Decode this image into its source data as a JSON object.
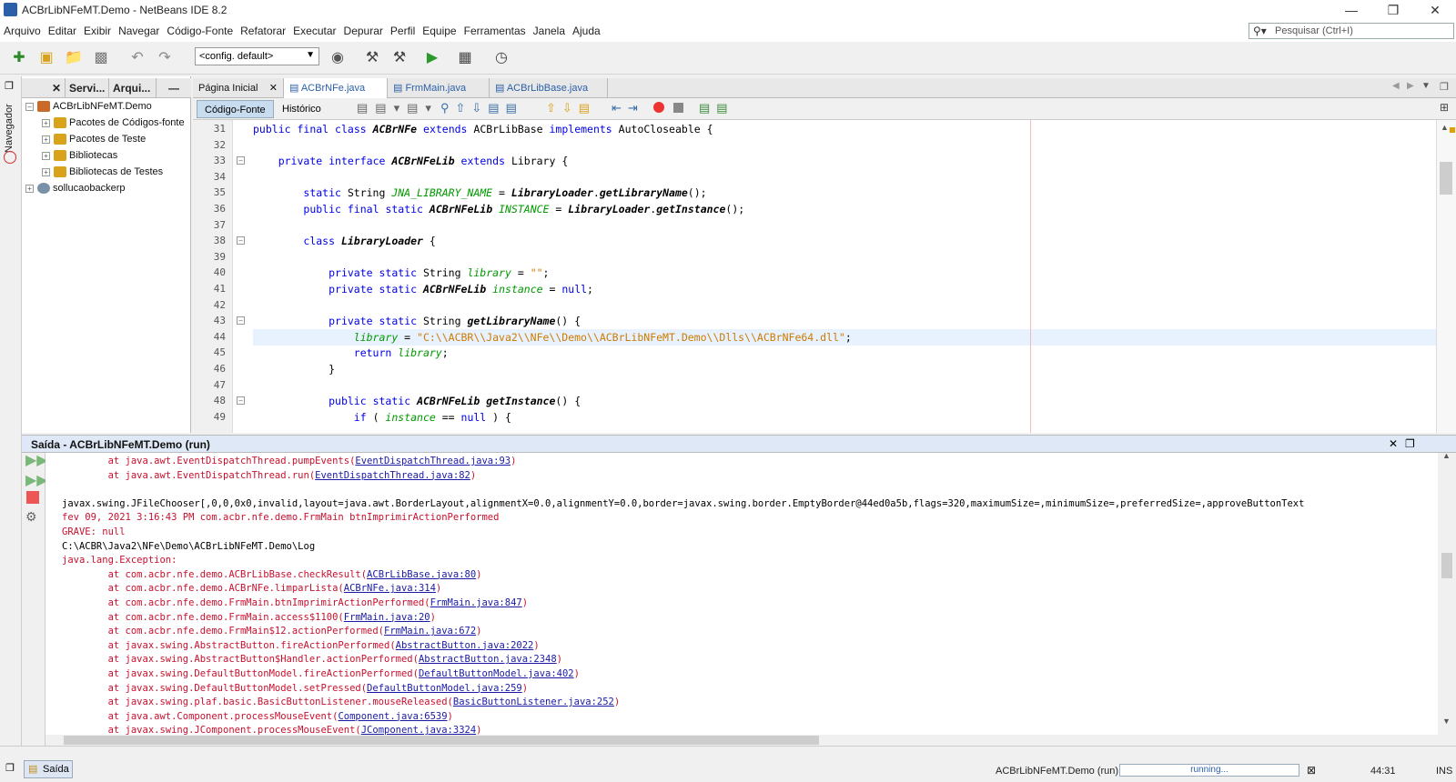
{
  "window": {
    "title": "ACBrLibNFeMT.Demo - NetBeans IDE 8.2"
  },
  "menu": [
    "Arquivo",
    "Editar",
    "Exibir",
    "Navegar",
    "Código-Fonte",
    "Refatorar",
    "Executar",
    "Depurar",
    "Perfil",
    "Equipe",
    "Ferramentas",
    "Janela",
    "Ajuda"
  ],
  "search": {
    "placeholder": "Pesquisar (Ctrl+I)"
  },
  "toolbar": {
    "config": "<config. default>"
  },
  "navigator_label": "Navegador",
  "project_tabs": [
    "Servi...",
    "Arqui..."
  ],
  "tree": [
    {
      "label": "ACBrLibNFeMT.Demo",
      "depth": 0
    },
    {
      "label": "Pacotes de Códigos-fonte",
      "depth": 1
    },
    {
      "label": "Pacotes de Teste",
      "depth": 1
    },
    {
      "label": "Bibliotecas",
      "depth": 1
    },
    {
      "label": "Bibliotecas de Testes",
      "depth": 1
    },
    {
      "label": "sollucaobackerp",
      "depth": 0
    }
  ],
  "editor_tabs": [
    {
      "label": "Página Inicial",
      "active": false
    },
    {
      "label": "ACBrNFe.java",
      "active": true
    },
    {
      "label": "FrmMain.java",
      "active": false
    },
    {
      "label": "ACBrLibBase.java",
      "active": false
    }
  ],
  "editor_views": {
    "source": "Código-Fonte",
    "history": "Histórico"
  },
  "code": [
    {
      "n": "31",
      "t": "public final class ACBrNFe extends ACBrLibBase implements AutoCloseable {"
    },
    {
      "n": "32",
      "t": ""
    },
    {
      "n": "33",
      "t": "    private interface ACBrNFeLib extends Library {"
    },
    {
      "n": "34",
      "t": ""
    },
    {
      "n": "35",
      "t": "        static String JNA_LIBRARY_NAME = LibraryLoader.getLibraryName();"
    },
    {
      "n": "36",
      "t": "        public final static ACBrNFeLib INSTANCE = LibraryLoader.getInstance();"
    },
    {
      "n": "37",
      "t": ""
    },
    {
      "n": "38",
      "t": "        class LibraryLoader {"
    },
    {
      "n": "39",
      "t": ""
    },
    {
      "n": "40",
      "t": "            private static String library = \"\";"
    },
    {
      "n": "41",
      "t": "            private static ACBrNFeLib instance = null;"
    },
    {
      "n": "42",
      "t": ""
    },
    {
      "n": "43",
      "t": "            private static String getLibraryName() {"
    },
    {
      "n": "44",
      "t": "                library = \"C:\\\\ACBR\\\\Java2\\\\NFe\\\\Demo\\\\ACBrLibNFeMT.Demo\\\\Dlls\\\\ACBrNFe64.dll\";"
    },
    {
      "n": "45",
      "t": "                return library;"
    },
    {
      "n": "46",
      "t": "            }"
    },
    {
      "n": "47",
      "t": ""
    },
    {
      "n": "48",
      "t": "            public static ACBrNFeLib getInstance() {"
    },
    {
      "n": "49",
      "t": "                if ( instance == null ) {"
    }
  ],
  "output": {
    "title": "Saída - ACBrLibNFeMT.Demo (run)",
    "lines": [
      {
        "pre": "        at java.awt.EventDispatchThread.pumpEvents(",
        "link": "EventDispatchThread.java:93",
        "post": ")",
        "err": true
      },
      {
        "pre": "        at java.awt.EventDispatchThread.run(",
        "link": "EventDispatchThread.java:82",
        "post": ")",
        "err": true
      },
      {
        "pre": "",
        "link": "",
        "post": "",
        "err": false
      },
      {
        "pre": "javax.swing.JFileChooser[,0,0,0x0,invalid,layout=java.awt.BorderLayout,alignmentX=0.0,alignmentY=0.0,border=javax.swing.border.EmptyBorder@44ed0a5b,flags=320,maximumSize=,minimumSize=,preferredSize=,approveButtonText",
        "link": "",
        "post": "",
        "err": false
      },
      {
        "pre": "fev 09, 2021 3:16:43 PM com.acbr.nfe.demo.FrmMain btnImprimirActionPerformed",
        "link": "",
        "post": "",
        "err": true
      },
      {
        "pre": "GRAVE: null",
        "link": "",
        "post": "",
        "err": true
      },
      {
        "pre": "C:\\ACBR\\Java2\\NFe\\Demo\\ACBrLibNFeMT.Demo\\Log",
        "link": "",
        "post": "",
        "err": false
      },
      {
        "pre": "java.lang.Exception:",
        "link": "",
        "post": "",
        "err": true
      },
      {
        "pre": "        at com.acbr.nfe.demo.ACBrLibBase.checkResult(",
        "link": "ACBrLibBase.java:80",
        "post": ")",
        "err": true
      },
      {
        "pre": "        at com.acbr.nfe.demo.ACBrNFe.limparLista(",
        "link": "ACBrNFe.java:314",
        "post": ")",
        "err": true
      },
      {
        "pre": "        at com.acbr.nfe.demo.FrmMain.btnImprimirActionPerformed(",
        "link": "FrmMain.java:847",
        "post": ")",
        "err": true
      },
      {
        "pre": "        at com.acbr.nfe.demo.FrmMain.access$1100(",
        "link": "FrmMain.java:20",
        "post": ")",
        "err": true
      },
      {
        "pre": "        at com.acbr.nfe.demo.FrmMain$12.actionPerformed(",
        "link": "FrmMain.java:672",
        "post": ")",
        "err": true
      },
      {
        "pre": "        at javax.swing.AbstractButton.fireActionPerformed(",
        "link": "AbstractButton.java:2022",
        "post": ")",
        "err": true
      },
      {
        "pre": "        at javax.swing.AbstractButton$Handler.actionPerformed(",
        "link": "AbstractButton.java:2348",
        "post": ")",
        "err": true
      },
      {
        "pre": "        at javax.swing.DefaultButtonModel.fireActionPerformed(",
        "link": "DefaultButtonModel.java:402",
        "post": ")",
        "err": true
      },
      {
        "pre": "        at javax.swing.DefaultButtonModel.setPressed(",
        "link": "DefaultButtonModel.java:259",
        "post": ")",
        "err": true
      },
      {
        "pre": "        at javax.swing.plaf.basic.BasicButtonListener.mouseReleased(",
        "link": "BasicButtonListener.java:252",
        "post": ")",
        "err": true
      },
      {
        "pre": "        at java.awt.Component.processMouseEvent(",
        "link": "Component.java:6539",
        "post": ")",
        "err": true
      },
      {
        "pre": "        at javax.swing.JComponent.processMouseEvent(",
        "link": "JComponent.java:3324",
        "post": ")",
        "err": true
      }
    ]
  },
  "status": {
    "output_tab": "Saída",
    "project": "ACBrLibNFeMT.Demo (run)",
    "progress": "running...",
    "position": "44:31",
    "mode": "INS"
  },
  "colors": {
    "keyword": "#0000e6",
    "string": "#ce7b00",
    "field": "#009900",
    "error": "#c8102e",
    "link": "#1a1aa6"
  }
}
